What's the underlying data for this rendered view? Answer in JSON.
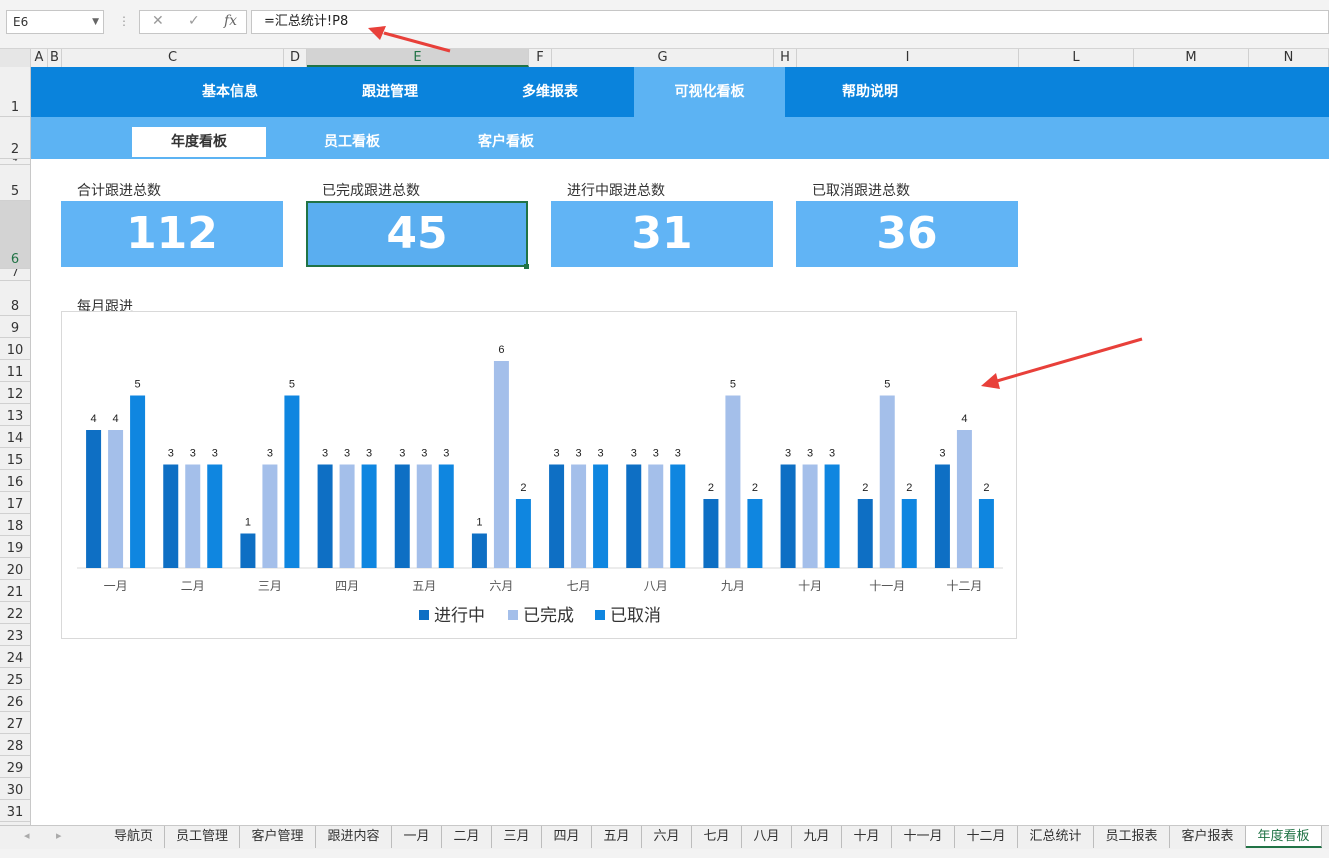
{
  "formula_bar": {
    "name_box": "E6",
    "formula": "=汇总统计!P8",
    "cancel_symbol": "✕",
    "enter_symbol": "✓",
    "fx_symbol": "fx"
  },
  "columns": [
    "A",
    "B",
    "C",
    "D",
    "E",
    "F",
    "G",
    "H",
    "I",
    "L",
    "M",
    "N"
  ],
  "rows": [
    "1",
    "2",
    "4",
    "5",
    "6",
    "7",
    "8",
    "9",
    "10",
    "11",
    "12",
    "13",
    "14",
    "15",
    "16",
    "17",
    "18",
    "19",
    "20",
    "21",
    "22",
    "23",
    "24",
    "25",
    "26",
    "27",
    "28",
    "29",
    "30",
    "31"
  ],
  "nav": {
    "tabs": [
      "基本信息",
      "跟进管理",
      "多维报表",
      "可视化看板",
      "帮助说明"
    ],
    "active_tab": "可视化看板",
    "subtabs": [
      "年度看板",
      "员工看板",
      "客户看板"
    ],
    "active_subtab": "年度看板"
  },
  "kpis": [
    {
      "label": "合计跟进总数",
      "value": "112"
    },
    {
      "label": "已完成跟进总数",
      "value": "45"
    },
    {
      "label": "进行中跟进总数",
      "value": "31"
    },
    {
      "label": "已取消跟进总数",
      "value": "36"
    }
  ],
  "chart_title_label": "每月跟进",
  "chart_data": {
    "type": "bar",
    "categories": [
      "一月",
      "二月",
      "三月",
      "四月",
      "五月",
      "六月",
      "七月",
      "八月",
      "九月",
      "十月",
      "十一月",
      "十二月"
    ],
    "series": [
      {
        "name": "进行中",
        "color": "#0e6fc4",
        "values": [
          4,
          3,
          1,
          3,
          3,
          1,
          3,
          3,
          2,
          3,
          2,
          3
        ]
      },
      {
        "name": "已完成",
        "color": "#a4bfea",
        "values": [
          4,
          3,
          3,
          3,
          3,
          6,
          3,
          3,
          5,
          3,
          5,
          4
        ]
      },
      {
        "name": "已取消",
        "color": "#0f86e0",
        "values": [
          5,
          3,
          5,
          3,
          3,
          2,
          3,
          3,
          2,
          3,
          2,
          2
        ]
      }
    ],
    "ylim": [
      0,
      6
    ],
    "legend": "bottom",
    "grid": false
  },
  "sheet_tabs": [
    "导航页",
    "员工管理",
    "客户管理",
    "跟进内容",
    "一月",
    "二月",
    "三月",
    "四月",
    "五月",
    "六月",
    "七月",
    "八月",
    "九月",
    "十月",
    "十一月",
    "十二月",
    "汇总统计",
    "员工报表",
    "客户报表",
    "年度看板"
  ],
  "active_sheet": "年度看板",
  "colors": {
    "nav": "#0a83dc",
    "subnav": "#5cb3f3",
    "kpi": "#61b4f5",
    "arrow": "#e8403a",
    "excel_green": "#217346"
  }
}
